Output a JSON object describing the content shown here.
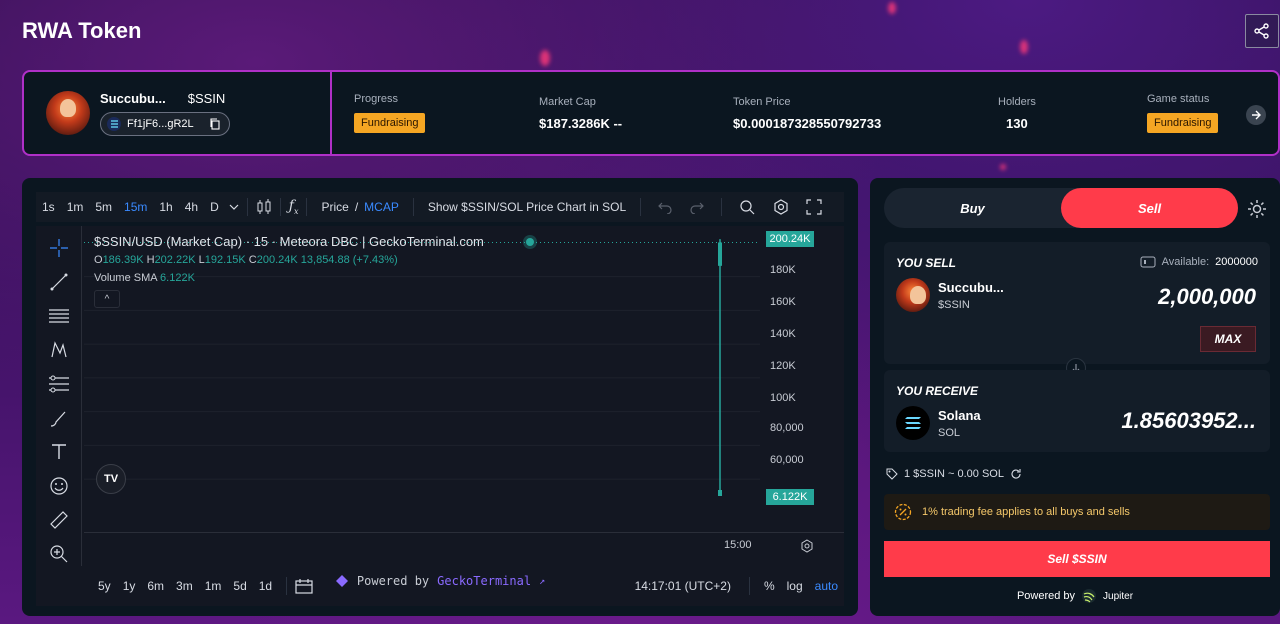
{
  "page": {
    "title": "RWA Token"
  },
  "token": {
    "name": "Succubu...",
    "symbol": "$SSIN",
    "address": "Ff1jF6...gR2L"
  },
  "stats": {
    "progress_label": "Progress",
    "progress_value": "Fundraising",
    "market_cap_label": "Market Cap",
    "market_cap_value": "$187.3286K --",
    "price_label": "Token Price",
    "price_value": "$0.000187328550792733",
    "holders_label": "Holders",
    "holders_value": "130",
    "game_status_label": "Game status",
    "game_status_value": "Fundraising"
  },
  "chart_toolbar": {
    "intervals": [
      "1s",
      "1m",
      "5m",
      "15m",
      "1h",
      "4h",
      "D"
    ],
    "active_interval": "15m",
    "price_label": "Price",
    "slash": "/",
    "mcap_label": "MCAP",
    "show_pair": "Show $SSIN/SOL Price Chart in SOL"
  },
  "chart": {
    "title": "$SSIN/USD (Market Cap) · 15 · Meteora DBC | GeckoTerminal.com",
    "ohlc": {
      "o_key": "O",
      "o": "186.39K",
      "h_key": "H",
      "h": "202.22K",
      "l_key": "L",
      "l": "192.15K",
      "c_key": "C",
      "c": "200.24K",
      "change": "13,854.88 (+7.43%)"
    },
    "volume_label": "Volume SMA",
    "volume_value": "6.122K",
    "price_ticks": [
      "180K",
      "160K",
      "140K",
      "120K",
      "100K",
      "80,000",
      "60,000"
    ],
    "last_price_tag": "200.24K",
    "volume_tag": "6.122K",
    "time_label": "15:00",
    "tv_logo": "TV",
    "collapse": "^"
  },
  "chart_data": {
    "type": "bar",
    "title": "$SSIN/USD (Market Cap) · 15 · Meteora DBC | GeckoTerminal.com",
    "categories": [
      "15:00"
    ],
    "series": [
      {
        "open": 186390,
        "high": 202220,
        "low": 50000,
        "close": 200240
      }
    ],
    "ylim": [
      50000,
      210000
    ],
    "yticks": [
      60000,
      80000,
      100000,
      120000,
      140000,
      160000,
      180000
    ]
  },
  "bottom_bar": {
    "ranges": [
      "5y",
      "1y",
      "6m",
      "3m",
      "1m",
      "5d",
      "1d"
    ],
    "clock": "14:17:01 (UTC+2)",
    "pct": "%",
    "log": "log",
    "auto": "auto"
  },
  "powered": {
    "prefix": "Powered by",
    "brand": "GeckoTerminal",
    "arrow": "↗"
  },
  "swap": {
    "buy_tab": "Buy",
    "sell_tab": "Sell",
    "you_sell": "YOU SELL",
    "available_label": "Available:",
    "available_value": "2000000",
    "sell_asset_name": "Succubu...",
    "sell_asset_symbol": "$SSIN",
    "sell_amount": "2,000,000",
    "max": "MAX",
    "you_receive": "YOU RECEIVE",
    "recv_asset_name": "Solana",
    "recv_asset_symbol": "SOL",
    "recv_amount": "1.85603952...",
    "rate": "1 $SSIN ~ 0.00 SOL",
    "fee_note": "1% trading fee applies to all buys and sells",
    "sell_button": "Sell $SSIN",
    "powered_by": "Powered by",
    "jupiter": "Jupiter"
  },
  "colors": {
    "accent_red": "#ff3b4a",
    "badge": "#f5a623",
    "candle_green": "#26a69a",
    "link_blue": "#3a8aff",
    "border_purple": "#b030c8"
  }
}
